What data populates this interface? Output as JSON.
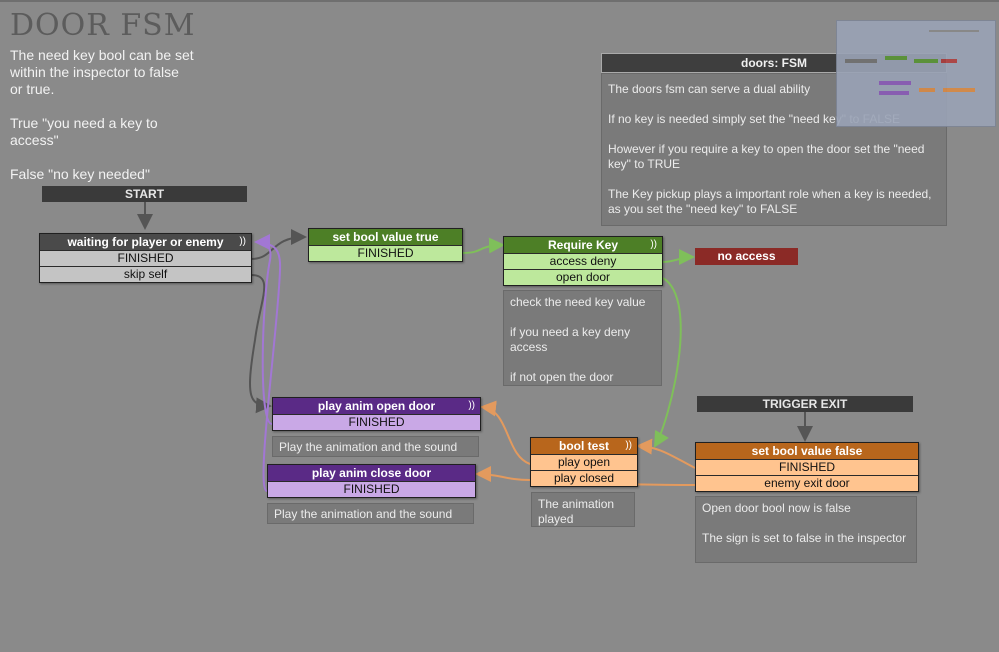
{
  "title": "DOOR FSM",
  "description": "The need key bool can be set\nwithin the inspector to false\nor true.\n\nTrue \"you need a key to\naccess\"\n\nFalse \"no key needed\"",
  "labels": {
    "start": "START",
    "trigger_exit": "TRIGGER EXIT"
  },
  "info_panel": {
    "header": "doors:  FSM",
    "body": "The doors fsm can serve a dual ability\n\nIf no key is needed simply set the \"need key\" to FALSE\n\nHowever if you require a key to open the door set the \"need key\" to TRUE\n\nThe Key pickup plays a important role when a key is needed, as you set the \"need key\" to FALSE"
  },
  "states": {
    "waiting": {
      "title": "waiting for player or enemy",
      "indicator": "))",
      "events": [
        "FINISHED",
        "skip self"
      ]
    },
    "set_true": {
      "title": "set bool value true",
      "events": [
        "FINISHED"
      ]
    },
    "require_key": {
      "title": "Require Key",
      "indicator": "))",
      "events": [
        "access deny",
        "open door"
      ]
    },
    "no_access": {
      "title": "no access"
    },
    "play_open": {
      "title": "play anim open door",
      "indicator": "))",
      "events": [
        "FINISHED"
      ]
    },
    "play_close": {
      "title": "play anim close door",
      "events": [
        "FINISHED"
      ]
    },
    "bool_test": {
      "title": "bool test",
      "indicator": "))",
      "events": [
        "play open",
        "play closed"
      ]
    },
    "set_false": {
      "title": "set bool value false",
      "events": [
        "FINISHED",
        "enemy exit door"
      ]
    }
  },
  "notes": {
    "require_key": "check the need key value\n\nif you need a key deny access\n\nif not open the door",
    "play_open": "Play the animation and the sound",
    "play_close": "Play the animation and the sound",
    "bool_test": "The animation played",
    "set_false": "Open door bool now is false\n\nThe sign is set to false in the inspector"
  },
  "colors": {
    "gray_header": "#4a4a4a",
    "gray_event": "#c4c4c4",
    "green_header": "#4d7f26",
    "green_event": "#bde89c",
    "purple_header": "#5a2a86",
    "purple_event": "#c9a8e6",
    "orange_header": "#b8661c",
    "orange_event": "#ffc48f",
    "red": "#8b2a26"
  }
}
